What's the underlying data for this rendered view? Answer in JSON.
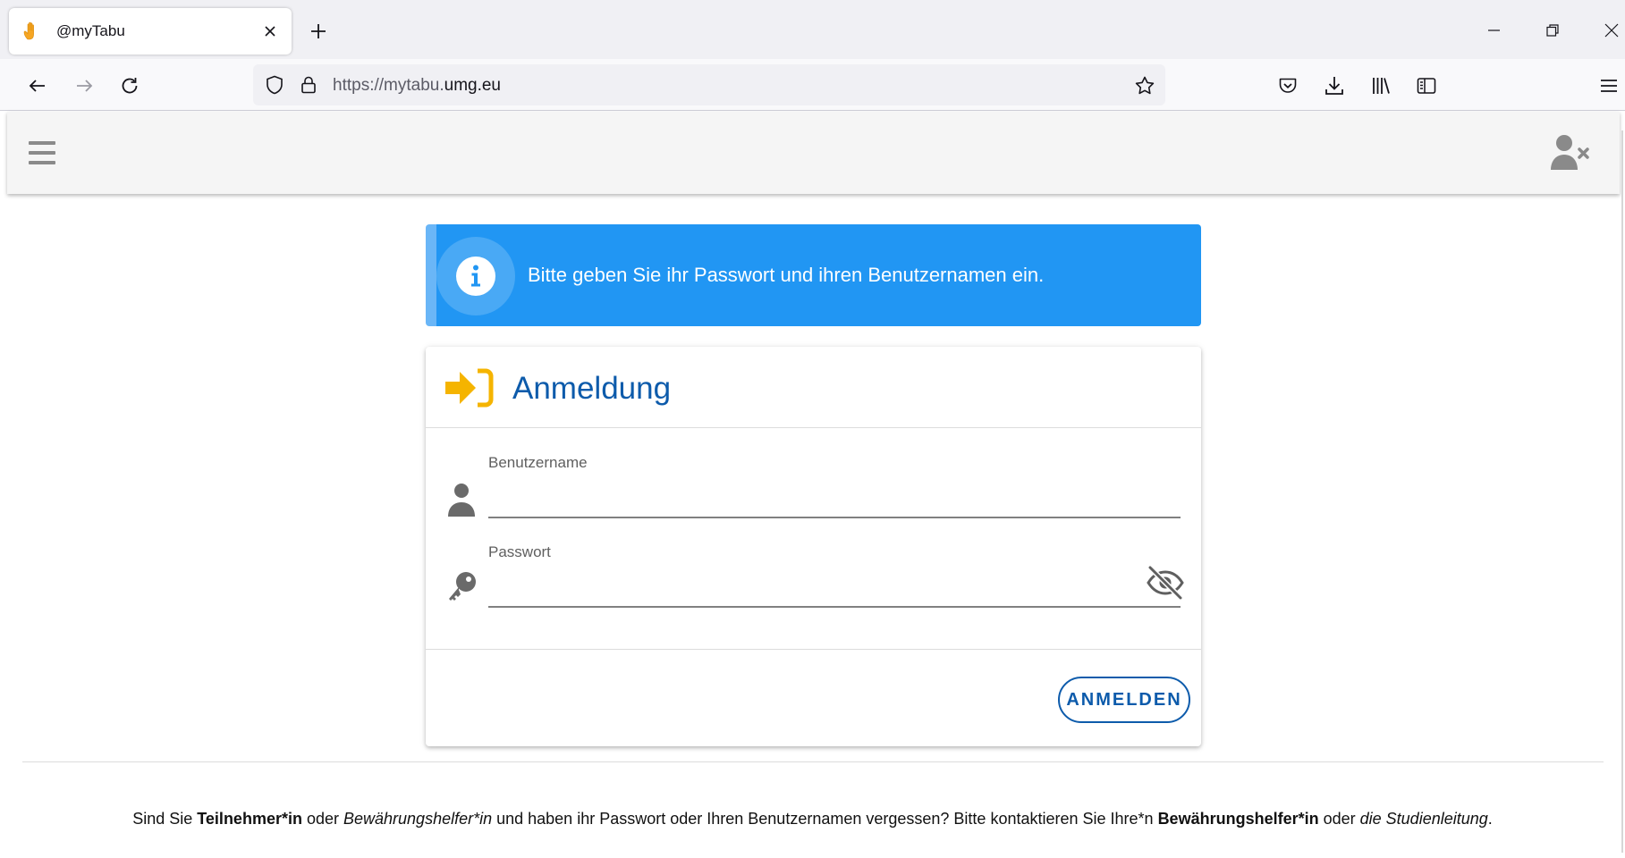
{
  "browser": {
    "tab": {
      "title": "@myTabu",
      "favicon": "hand-icon"
    },
    "url": {
      "prefix": "https://mytabu.",
      "host": "umg.eu"
    }
  },
  "alert": {
    "text": "Bitte geben Sie ihr Passwort und ihren Benutzernamen ein.",
    "icon": "info-icon",
    "color": "#2196f3"
  },
  "login": {
    "title": "Anmeldung",
    "username": {
      "label": "Benutzername",
      "value": ""
    },
    "password": {
      "label": "Passwort",
      "value": ""
    },
    "submit_label": "ANMELDEN",
    "accent": "#0d5bab",
    "icon_color": "#f5b400"
  },
  "footer": {
    "t1": "Sind Sie ",
    "b1": "Teilnehmer*in",
    "t2": " oder ",
    "i1": "Bewährungshelfer*in",
    "t3": " und haben ihr Passwort oder Ihren Benutzernamen vergessen? Bitte kontaktieren Sie Ihre*n ",
    "b2": "Bewährungshelfer*in",
    "t4": " oder ",
    "i2": "die Studienleitung",
    "t5": "."
  }
}
